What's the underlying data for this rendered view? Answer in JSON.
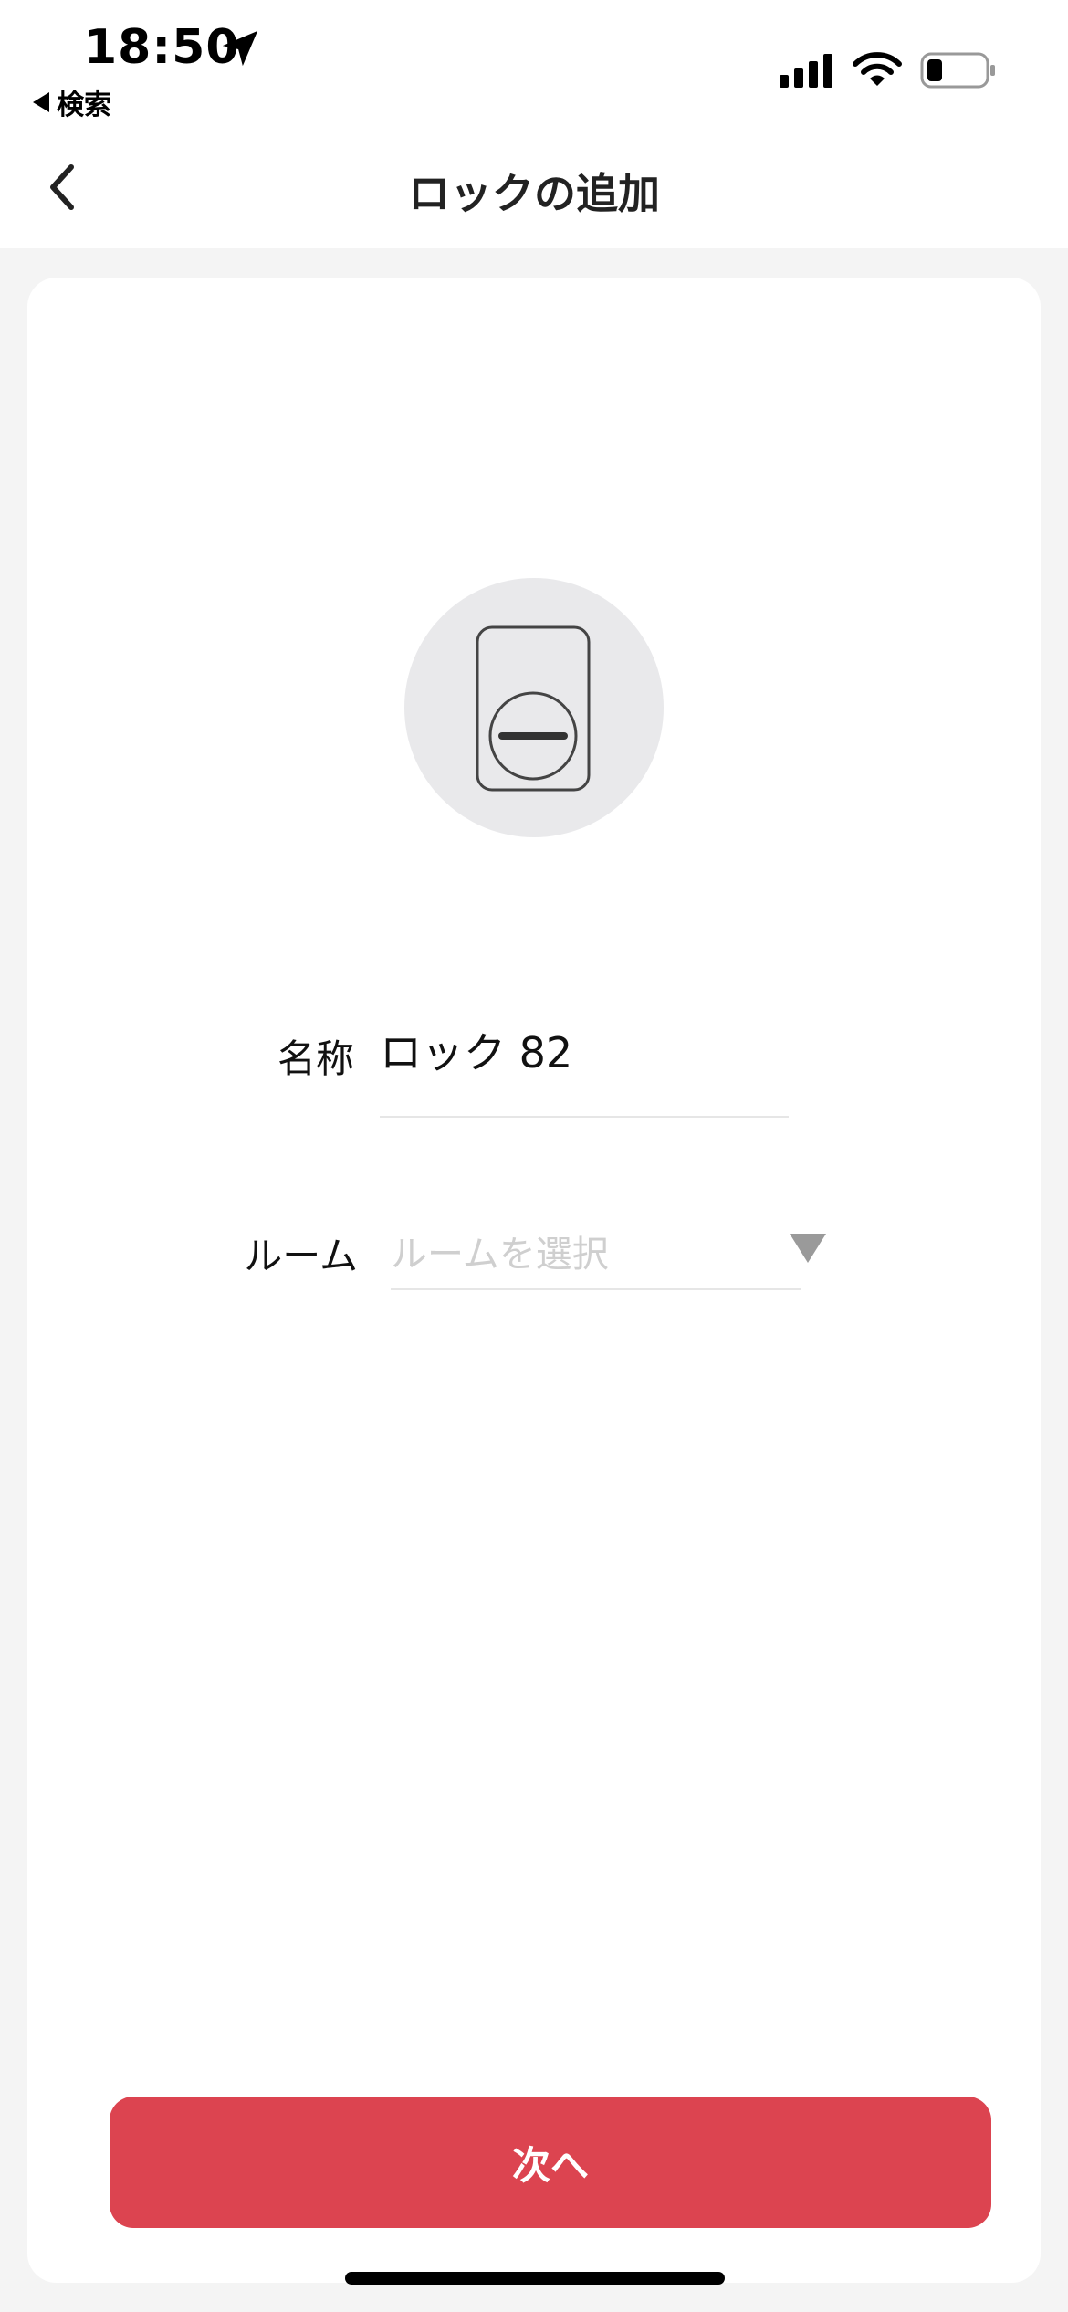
{
  "status_bar": {
    "time": "18:50",
    "back_app_label": "検索",
    "icons": [
      "location-arrow-icon",
      "cellular-signal-icon",
      "wifi-icon",
      "battery-icon"
    ]
  },
  "header": {
    "back_icon": "chevron-left-icon",
    "title": "ロックの追加"
  },
  "device": {
    "icon": "smart-lock-icon"
  },
  "form": {
    "name_label": "名称",
    "name_value": "ロック 82",
    "room_label": "ルーム",
    "room_placeholder": "ルームを選択",
    "room_dropdown_icon": "dropdown-triangle-icon"
  },
  "footer": {
    "next_label": "次へ"
  },
  "colors": {
    "accent": "#dc4450",
    "background": "#f4f4f4",
    "card": "#ffffff",
    "device_circle": "#e9e9eb"
  }
}
